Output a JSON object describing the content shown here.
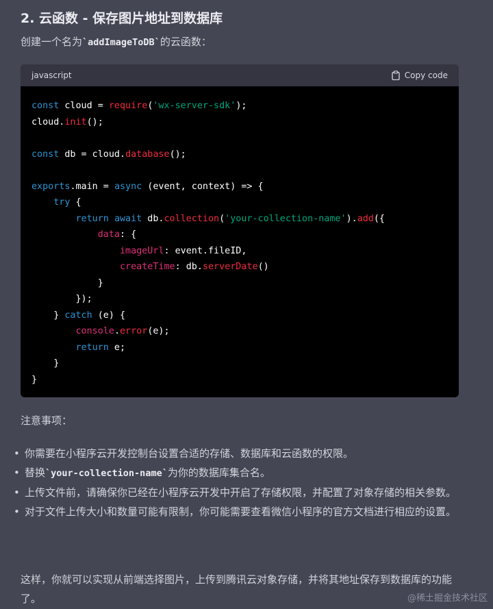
{
  "heading": "2. 云函数 - 保存图片地址到数据库",
  "intro": {
    "before": "创建一个名为",
    "code": "`addImageToDB`",
    "after": "的云函数："
  },
  "code_block": {
    "language": "javascript",
    "copy_label": "Copy code",
    "icon": "clipboard-icon",
    "lines": [
      [
        [
          "kw",
          "const"
        ],
        [
          "p",
          " cloud = "
        ],
        [
          "fn",
          "require"
        ],
        [
          "p",
          "("
        ],
        [
          "str",
          "'wx-server-sdk'"
        ],
        [
          "p",
          ");"
        ]
      ],
      [
        [
          "p",
          "cloud."
        ],
        [
          "fn",
          "init"
        ],
        [
          "p",
          "();"
        ]
      ],
      [],
      [
        [
          "kw",
          "const"
        ],
        [
          "p",
          " db = cloud."
        ],
        [
          "fn",
          "database"
        ],
        [
          "p",
          "();"
        ]
      ],
      [],
      [
        [
          "kw",
          "exports"
        ],
        [
          "p",
          ".main = "
        ],
        [
          "kw",
          "async"
        ],
        [
          "p",
          " (event, context) => {"
        ]
      ],
      [
        [
          "p",
          "    "
        ],
        [
          "kw",
          "try"
        ],
        [
          "p",
          " {"
        ]
      ],
      [
        [
          "p",
          "        "
        ],
        [
          "kw",
          "return"
        ],
        [
          "p",
          " "
        ],
        [
          "kw",
          "await"
        ],
        [
          "p",
          " db."
        ],
        [
          "fn",
          "collection"
        ],
        [
          "p",
          "("
        ],
        [
          "str",
          "'your-collection-name'"
        ],
        [
          "p",
          ")."
        ],
        [
          "fn",
          "add"
        ],
        [
          "p",
          "({"
        ]
      ],
      [
        [
          "p",
          "            "
        ],
        [
          "prop",
          "data"
        ],
        [
          "p",
          ": {"
        ]
      ],
      [
        [
          "p",
          "                "
        ],
        [
          "prop",
          "imageUrl"
        ],
        [
          "p",
          ": event.fileID,"
        ]
      ],
      [
        [
          "p",
          "                "
        ],
        [
          "prop",
          "createTime"
        ],
        [
          "p",
          ": db."
        ],
        [
          "fn",
          "serverDate"
        ],
        [
          "p",
          "()"
        ]
      ],
      [
        [
          "p",
          "            }"
        ]
      ],
      [
        [
          "p",
          "        });"
        ]
      ],
      [
        [
          "p",
          "    } "
        ],
        [
          "kw",
          "catch"
        ],
        [
          "p",
          " (e) {"
        ]
      ],
      [
        [
          "p",
          "        "
        ],
        [
          "prop",
          "console"
        ],
        [
          "p",
          "."
        ],
        [
          "fn",
          "error"
        ],
        [
          "p",
          "(e);"
        ]
      ],
      [
        [
          "p",
          "        "
        ],
        [
          "kw",
          "return"
        ],
        [
          "p",
          " e;"
        ]
      ],
      [
        [
          "p",
          "    }"
        ]
      ],
      [
        [
          "p",
          "}"
        ]
      ]
    ]
  },
  "notes_title": "注意事项：",
  "notes": [
    {
      "text": "你需要在小程序云开发控制台设置合适的存储、数据库和云函数的权限。"
    },
    {
      "before": "替换",
      "code": "`your-collection-name`",
      "after": "为你的数据库集合名。"
    },
    {
      "text": "上传文件前，请确保你已经在小程序云开发中开启了存储权限，并配置了对象存储的相关参数。"
    },
    {
      "text": "对于文件上传大小和数量可能有限制，你可能需要查看微信小程序的官方文档进行相应的设置。"
    }
  ],
  "conclusion": "这样，你就可以实现从前端选择图片，上传到腾讯云对象存储，并将其地址保存到数据库的功能了。",
  "watermark": "@稀土掘金技术社区",
  "colors": {
    "background": "#444654",
    "code_bg": "#000000",
    "code_header_bg": "#343541",
    "keyword": "#2e95d3",
    "function": "#f22c3d",
    "string": "#00a67d",
    "property": "#df3079"
  }
}
